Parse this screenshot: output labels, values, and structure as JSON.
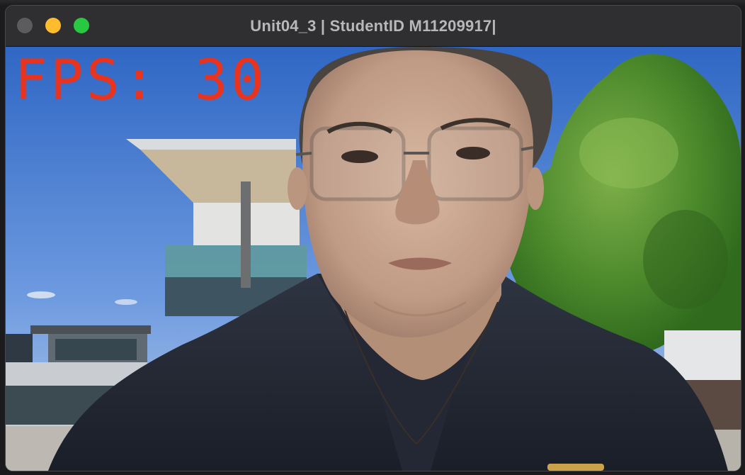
{
  "window": {
    "title": "Unit04_3 | StudentID M11209917|",
    "controls": {
      "close_color": "#5c5c5e",
      "minimize_color": "#febc2e",
      "maximize_color": "#28c840"
    }
  },
  "video": {
    "fps_label": "FPS: 30",
    "overlay_color": "#e8341f",
    "scene": [
      "sky",
      "modern-building",
      "tree",
      "person-foreground"
    ]
  }
}
